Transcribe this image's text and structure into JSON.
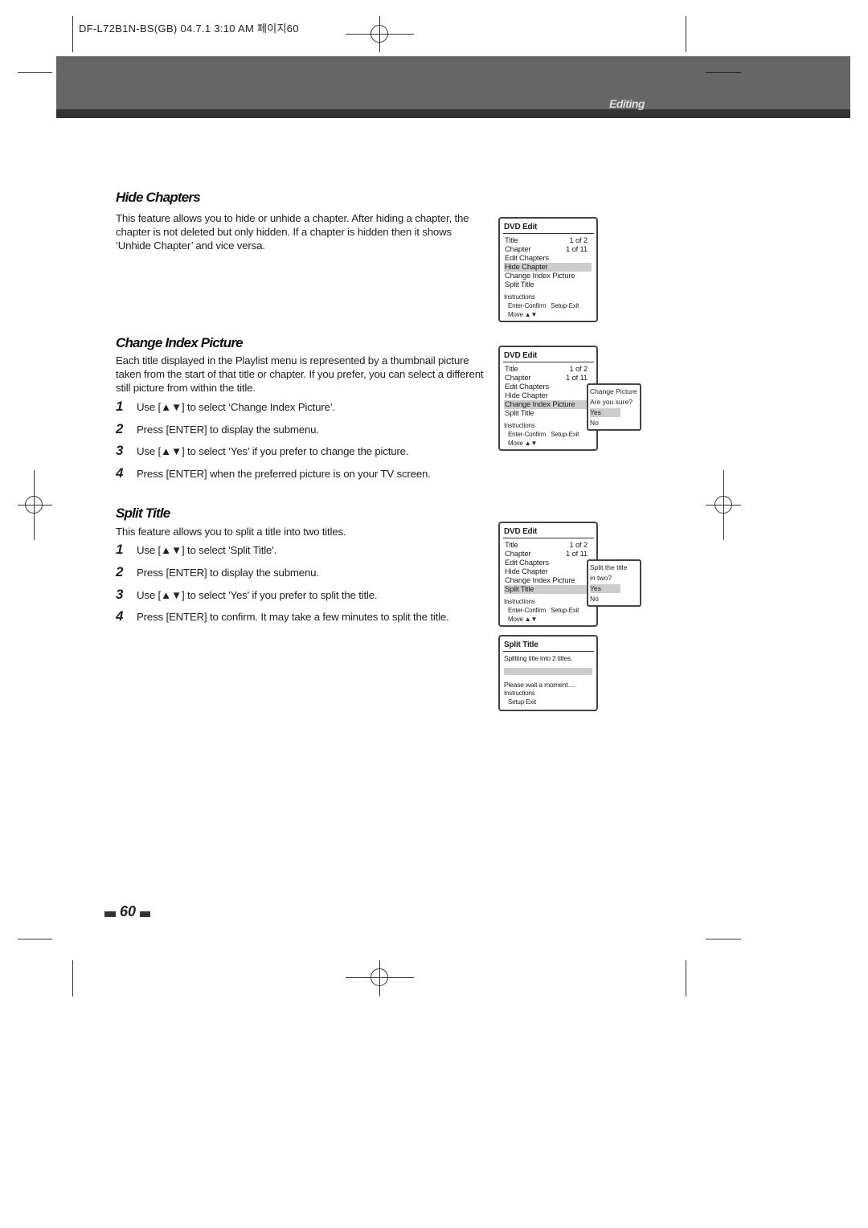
{
  "header": {
    "slug": "DF-L72B1N-BS(GB)  04.7.1 3:10 AM  페이지60",
    "section": "Editing"
  },
  "sections": [
    {
      "heading": "Hide Chapters",
      "body": "This feature allows you to hide or unhide a chapter. After hiding a chapter, the chapter is not deleted but only hidden. If a chapter is hidden then it shows ‘Unhide Chapter’ and vice versa.",
      "steps": []
    },
    {
      "heading": "Change Index Picture",
      "body": "Each title displayed in the Playlist menu is represented by a thumbnail picture taken from the start of that title or chapter. If you prefer, you can select a different still picture from within the title.",
      "steps": [
        {
          "n": "1",
          "text": "Use [▲▼] to select ‘Change Index Picture’."
        },
        {
          "n": "2",
          "text": "Press [ENTER] to display the submenu."
        },
        {
          "n": "3",
          "text": "Use [▲▼] to select ‘Yes’ if you prefer to change the picture."
        },
        {
          "n": "4",
          "text": "Press [ENTER] when the preferred picture is on your TV screen."
        }
      ]
    },
    {
      "heading": "Split Title",
      "body": "This feature allows you to split a title into two titles.",
      "steps": [
        {
          "n": "1",
          "text": "Use [▲▼] to select 'Split Title'."
        },
        {
          "n": "2",
          "text": "Press [ENTER] to display the submenu."
        },
        {
          "n": "3",
          "text": "Use [▲▼] to select 'Yes' if you prefer to split the title."
        },
        {
          "n": "4",
          "text": "Press [ENTER] to confirm. It may take a few minutes to split the title."
        }
      ]
    }
  ],
  "menus": [
    {
      "title": "DVD Edit",
      "rows": [
        {
          "label": "Title",
          "value": "1 of 2"
        },
        {
          "label": "Chapter",
          "value": "1 of 11"
        },
        {
          "label": "Edit Chapters"
        },
        {
          "label": "Hide Chapter"
        },
        {
          "label": "Change Index Picture"
        },
        {
          "label": "Split Title"
        }
      ],
      "selected": 3,
      "instructions": "Instructions",
      "keys": "Enter-Confirm   Setup-Exit",
      "move": "Move ▲▼"
    },
    {
      "title": "DVD Edit",
      "rows": [
        {
          "label": "Title",
          "value": "1 of 2"
        },
        {
          "label": "Chapter",
          "value": "1 of 11"
        },
        {
          "label": "Edit Chapters"
        },
        {
          "label": "Hide Chapter"
        },
        {
          "label": "Change Index Picture"
        },
        {
          "label": "Split Title"
        }
      ],
      "selected": 4,
      "instructions": "Instructions",
      "keys": "Enter-Confirm   Setup-Exit",
      "move": "Move ▲▼",
      "popup": {
        "lines": [
          "Change Picture",
          "Are you sure?"
        ],
        "options": [
          "Yes",
          "No"
        ],
        "selected": 0
      }
    },
    {
      "title": "DVD Edit",
      "rows": [
        {
          "label": "Title",
          "value": "1 of 2"
        },
        {
          "label": "Chapter",
          "value": "1 of 11"
        },
        {
          "label": "Edit Chapters"
        },
        {
          "label": "Hide Chapter"
        },
        {
          "label": "Change Index Picture"
        },
        {
          "label": "Split Title"
        }
      ],
      "selected": 5,
      "instructions": "Instructions",
      "keys": "Enter-Confirm   Setup-Exit",
      "move": "Move ▲▼",
      "popup": {
        "lines": [
          "Split the title",
          "in two?"
        ],
        "options": [
          "Yes",
          "No"
        ],
        "selected": 0
      }
    }
  ],
  "progress_box": {
    "title": "Split Title",
    "message": "Splitting title into 2 titles.",
    "wait": "Please wait a moment....",
    "instructions": "Instructions",
    "keys": "Setup-Exit"
  },
  "page_number": "60"
}
